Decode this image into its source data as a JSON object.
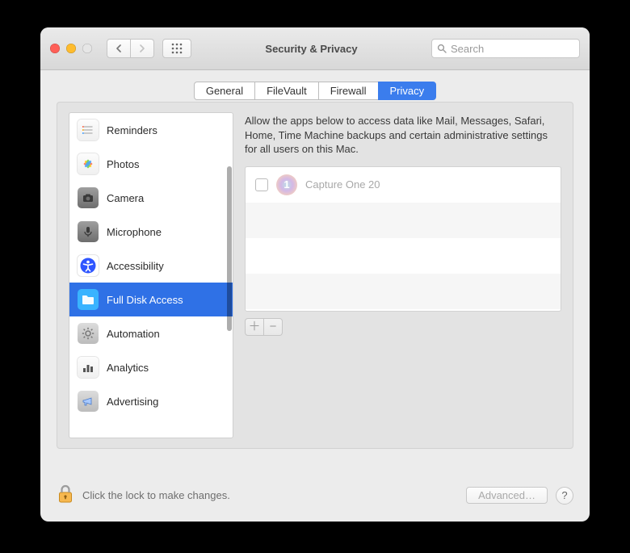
{
  "window": {
    "title": "Security & Privacy",
    "search_placeholder": "Search"
  },
  "tabs": [
    {
      "label": "General",
      "active": false
    },
    {
      "label": "FileVault",
      "active": false
    },
    {
      "label": "Firewall",
      "active": false
    },
    {
      "label": "Privacy",
      "active": true
    }
  ],
  "description": "Allow the apps below to access data like Mail, Messages, Safari, Home, Time Machine backups and certain administrative settings for all users on this Mac.",
  "sidebar": {
    "items": [
      {
        "label": "Reminders",
        "icon": "reminders-icon"
      },
      {
        "label": "Photos",
        "icon": "photos-icon"
      },
      {
        "label": "Camera",
        "icon": "camera-icon"
      },
      {
        "label": "Microphone",
        "icon": "microphone-icon"
      },
      {
        "label": "Accessibility",
        "icon": "accessibility-icon"
      },
      {
        "label": "Full Disk Access",
        "icon": "folder-icon",
        "selected": true
      },
      {
        "label": "Automation",
        "icon": "gear-icon"
      },
      {
        "label": "Analytics",
        "icon": "bar-chart-icon"
      },
      {
        "label": "Advertising",
        "icon": "megaphone-icon"
      }
    ]
  },
  "apps": [
    {
      "label": "Capture One 20",
      "checked": false,
      "icon_glyph": "1"
    }
  ],
  "footer": {
    "lock_text": "Click the lock to make changes.",
    "advanced_label": "Advanced…",
    "help_label": "?"
  },
  "colors": {
    "accent": "#2f71e6"
  }
}
